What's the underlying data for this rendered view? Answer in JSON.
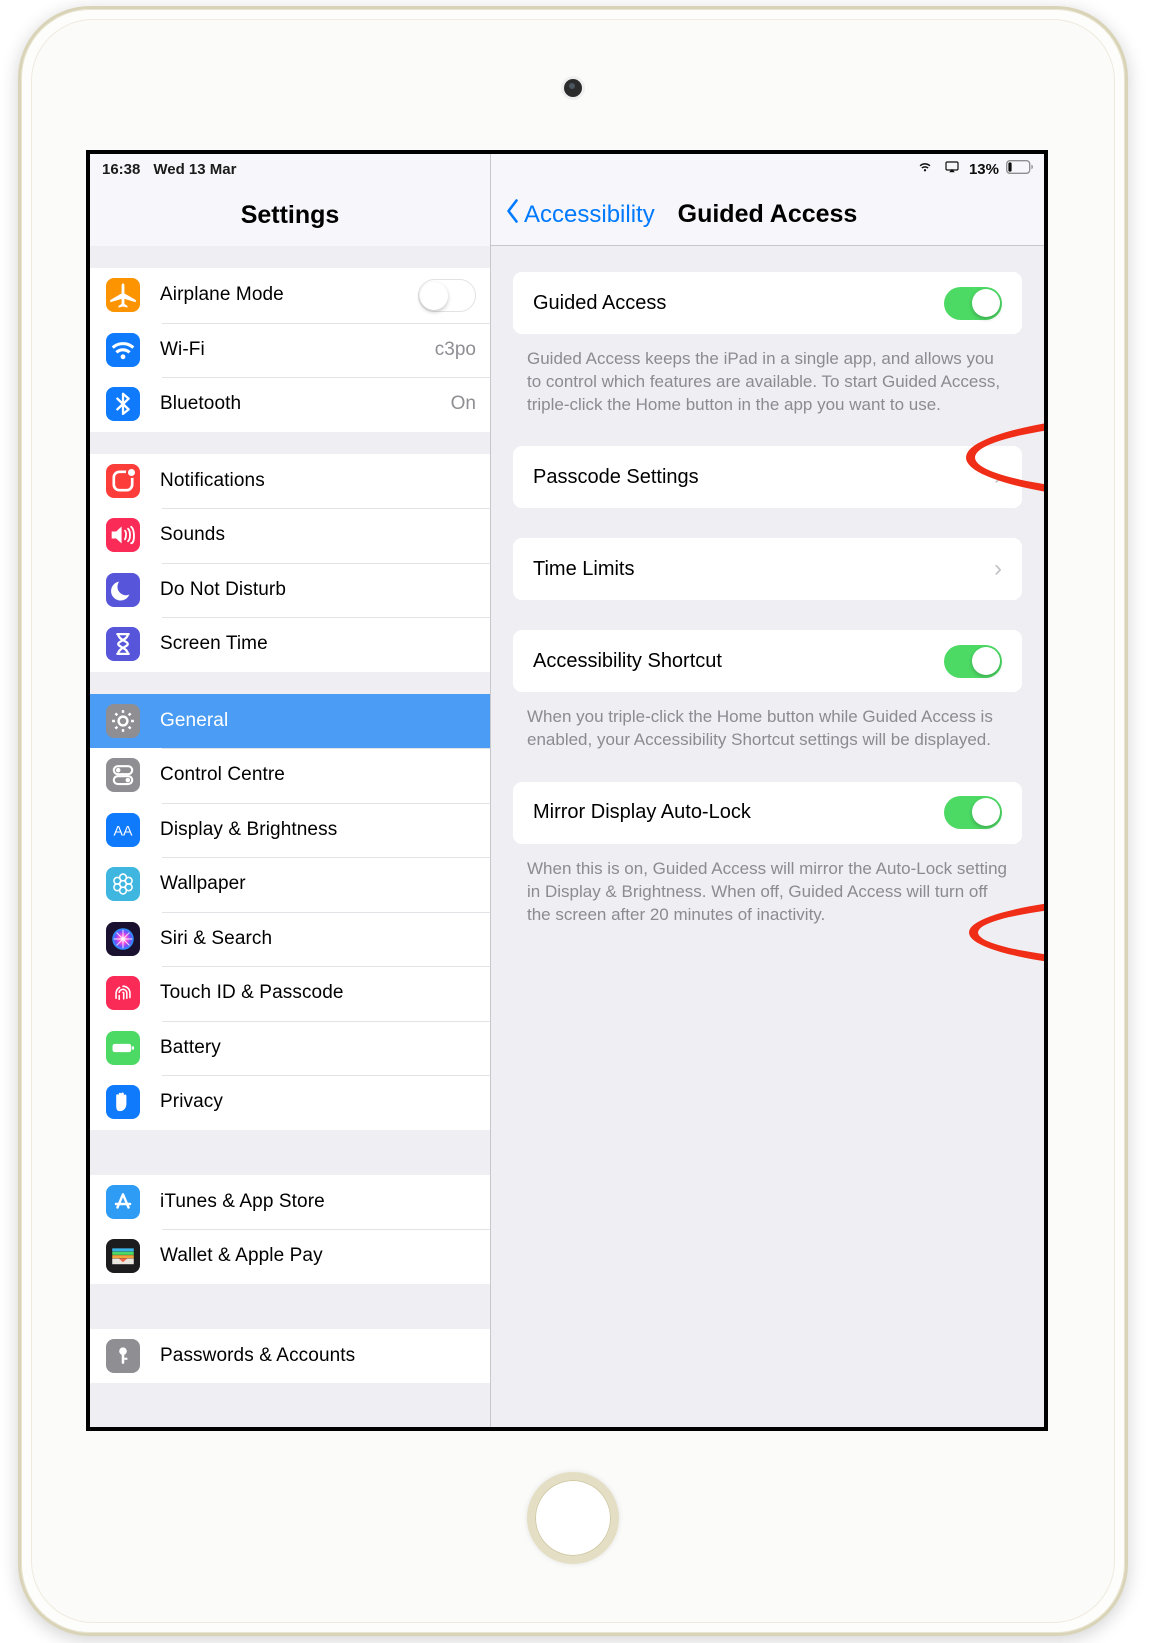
{
  "device": {
    "name": "iPad",
    "camera": "front-camera",
    "home_button": "home-button"
  },
  "status_bar": {
    "time": "16:38",
    "date": "Wed 13 Mar",
    "wifi_icon": "wifi-icon",
    "airplay_icon": "airplay-icon",
    "battery_percent": "13%",
    "battery_icon": "battery-icon"
  },
  "sidebar": {
    "title": "Settings",
    "groups": [
      {
        "items": [
          {
            "label": "Airplane Mode",
            "icon": "airplane-icon",
            "control": "toggle",
            "toggle_on": false
          },
          {
            "label": "Wi-Fi",
            "icon": "wifi-icon",
            "value": "c3po"
          },
          {
            "label": "Bluetooth",
            "icon": "bluetooth-icon",
            "value": "On"
          }
        ]
      },
      {
        "items": [
          {
            "label": "Notifications",
            "icon": "notifications-icon"
          },
          {
            "label": "Sounds",
            "icon": "sounds-icon"
          },
          {
            "label": "Do Not Disturb",
            "icon": "do-not-disturb-icon"
          },
          {
            "label": "Screen Time",
            "icon": "screen-time-icon"
          }
        ]
      },
      {
        "items": [
          {
            "label": "General",
            "icon": "general-gear-icon",
            "selected": true
          },
          {
            "label": "Control Centre",
            "icon": "control-centre-icon"
          },
          {
            "label": "Display & Brightness",
            "icon": "display-brightness-icon"
          },
          {
            "label": "Wallpaper",
            "icon": "wallpaper-icon"
          },
          {
            "label": "Siri & Search",
            "icon": "siri-search-icon"
          },
          {
            "label": "Touch ID & Passcode",
            "icon": "touch-id-icon"
          },
          {
            "label": "Battery",
            "icon": "battery-settings-icon"
          },
          {
            "label": "Privacy",
            "icon": "privacy-hand-icon"
          }
        ]
      },
      {
        "items": [
          {
            "label": "iTunes & App Store",
            "icon": "app-store-icon"
          },
          {
            "label": "Wallet & Apple Pay",
            "icon": "wallet-icon"
          }
        ]
      },
      {
        "items": [
          {
            "label": "Passwords & Accounts",
            "icon": "passwords-key-icon"
          }
        ]
      }
    ]
  },
  "detail": {
    "back_label": "Accessibility",
    "back_icon": "chevron-left-icon",
    "title": "Guided Access",
    "sections": [
      {
        "rows": [
          {
            "label": "Guided Access",
            "control": "toggle",
            "toggle_on": true,
            "highlighted": true
          }
        ],
        "footnote": "Guided Access keeps the iPad in a single app, and allows you to control which features are available. To start Guided Access, triple-click the Home button in the app you want to use."
      },
      {
        "rows": [
          {
            "label": "Passcode Settings",
            "control": "chevron",
            "chevron": "›"
          }
        ],
        "footnote": ""
      },
      {
        "rows": [
          {
            "label": "Time Limits",
            "control": "chevron",
            "chevron": "›"
          }
        ],
        "footnote": ""
      },
      {
        "rows": [
          {
            "label": "Accessibility Shortcut",
            "control": "toggle",
            "toggle_on": true
          }
        ],
        "footnote": "When you triple-click the Home button while Guided Access is enabled, your Accessibility Shortcut settings will be displayed."
      },
      {
        "rows": [
          {
            "label": "Mirror Display Auto-Lock",
            "control": "toggle",
            "toggle_on": true,
            "highlighted": true
          }
        ],
        "footnote": "When this is on, Guided Access will mirror the Auto-Lock setting in Display & Brightness. When off, Guided Access will turn off the screen after 20 minutes of inactivity."
      }
    ]
  },
  "annotations": [
    {
      "name": "ellipse-guided-access",
      "target": "Guided Access",
      "color": "#f02d16"
    },
    {
      "name": "ellipse-mirror-lock",
      "target": "Mirror Display Auto-Lock",
      "color": "#f02d16"
    }
  ],
  "colors": {
    "accent_blue": "#007aff",
    "selected_row": "#4b9cf5",
    "toggle_on": "#4cd964",
    "annotation_red": "#f02d16",
    "group_background": "#efeef3"
  }
}
